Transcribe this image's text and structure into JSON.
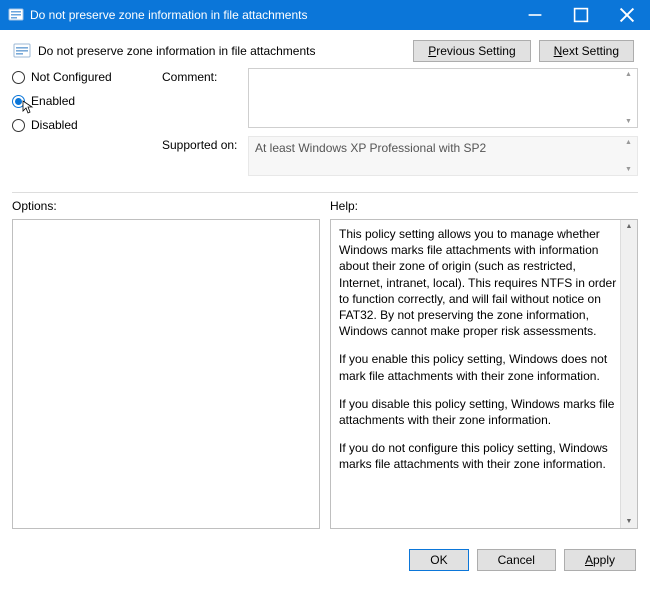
{
  "window": {
    "title": "Do not preserve zone information in file attachments",
    "header": "Do not preserve zone information in file attachments"
  },
  "nav": {
    "previous": "Previous Setting",
    "previous_ul": "P",
    "next": "Next Setting",
    "next_ul": "N"
  },
  "radios": {
    "not_configured": "Not Configured",
    "not_configured_ul": "C",
    "enabled": "Enabled",
    "enabled_ul": "E",
    "disabled": "Disabled",
    "disabled_ul": "D",
    "selected": "enabled"
  },
  "fields": {
    "comment_label": "Comment:",
    "comment_value": "",
    "supported_label": "Supported on:",
    "supported_value": "At least Windows XP Professional with SP2"
  },
  "panels": {
    "options_label": "Options:",
    "help_label": "Help:",
    "help_p1": "This policy setting allows you to manage whether Windows marks file attachments with information about their zone of origin (such as restricted, Internet, intranet, local). This requires NTFS in order to function correctly, and will fail without notice on FAT32. By not preserving the zone information, Windows cannot make proper risk assessments.",
    "help_p2": "If you enable this policy setting, Windows does not mark file attachments with their zone information.",
    "help_p3": "If you disable this policy setting, Windows marks file attachments with their zone information.",
    "help_p4": "If you do not configure this policy setting, Windows marks file attachments with their zone information."
  },
  "footer": {
    "ok": "OK",
    "cancel": "Cancel",
    "apply": "Apply",
    "apply_ul": "A"
  }
}
